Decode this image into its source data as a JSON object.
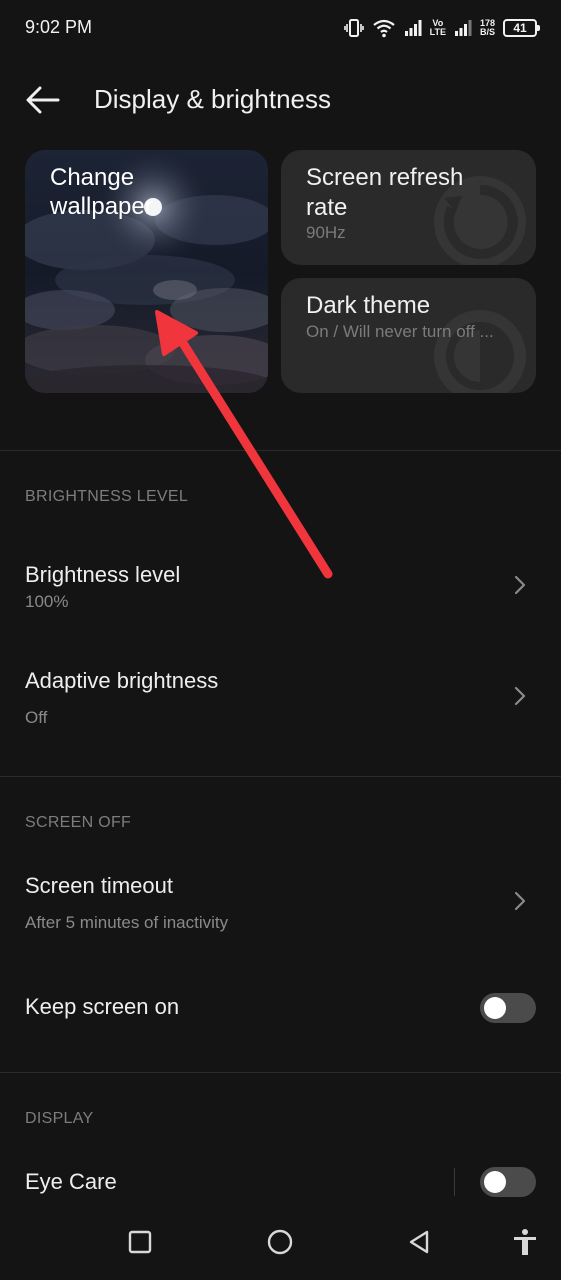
{
  "status_bar": {
    "time": "9:02 PM",
    "volte_top": "Vo",
    "volte_bottom": "LTE",
    "net_speed_value": "178",
    "net_speed_unit": "B/S",
    "battery": "41"
  },
  "header": {
    "title": "Display & brightness"
  },
  "cards": {
    "wallpaper_label": "Change wallpaper",
    "refresh_title": "Screen refresh rate",
    "refresh_value": "90Hz",
    "dark_title": "Dark theme",
    "dark_value": "On / Will never turn off ..."
  },
  "sections": {
    "brightness_header": "BRIGHTNESS LEVEL",
    "brightness_level_title": "Brightness level",
    "brightness_level_value": "100%",
    "adaptive_title": "Adaptive brightness",
    "adaptive_value": "Off",
    "screen_off_header": "SCREEN OFF",
    "timeout_title": "Screen timeout",
    "timeout_value": "After 5 minutes of inactivity",
    "keep_on_title": "Keep screen on",
    "keep_on_enabled": false,
    "display_header": "DISPLAY",
    "eye_care_title": "Eye Care",
    "eye_care_enabled": false
  },
  "icons": {
    "back": "arrow-left-icon",
    "chevron": "chevron-right-icon",
    "nav_recents": "square-icon",
    "nav_home": "circle-icon",
    "nav_back": "triangle-back-icon",
    "accessibility": "accessibility-icon"
  },
  "colors": {
    "background": "#141414",
    "tile": "#2a2a2a",
    "annotation": "#f0353c",
    "toggle_off": "#4b4b4b"
  }
}
